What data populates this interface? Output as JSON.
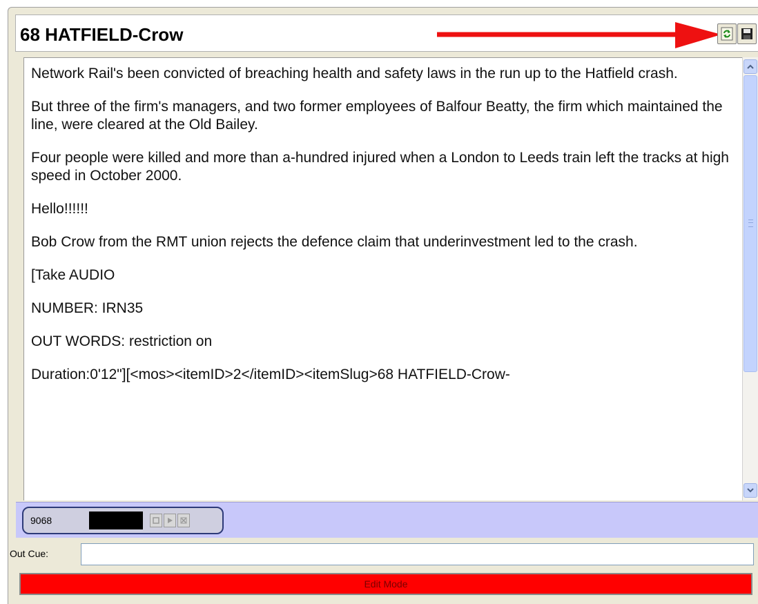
{
  "title": "68 HATFIELD-Crow",
  "toolbar": {
    "refresh_icon": "refresh-icon",
    "save_icon": "floppy-disk-icon"
  },
  "annotation": {
    "arrow_color": "#ee1111"
  },
  "script": {
    "paragraphs": [
      "Network Rail's been convicted of breaching health and safety laws in the run up to the Hatfield crash.",
      "But three of the firm's managers, and two former employees of Balfour Beatty, the firm which maintained the line, were cleared at the Old Bailey.",
      "Four people were killed and more than a-hundred injured when a London to Leeds train left the tracks at high speed in October 2000.",
      "Hello!!!!!!",
      "Bob Crow from the RMT union rejects the defence claim that underinvestment led to the crash.",
      "[Take AUDIO",
      "NUMBER: IRN35",
      "OUT WORDS: restriction on",
      "Duration:0'12\"][<mos><itemID>2</itemID><itemSlug>68 HATFIELD-Crow-"
    ]
  },
  "media": {
    "id": "9068",
    "buttons": [
      "stop-icon",
      "play-icon",
      "close-icon"
    ]
  },
  "out_cue": {
    "label": "Out Cue:",
    "value": ""
  },
  "mode": {
    "label": "Edit Mode",
    "color": "#ff0000"
  }
}
